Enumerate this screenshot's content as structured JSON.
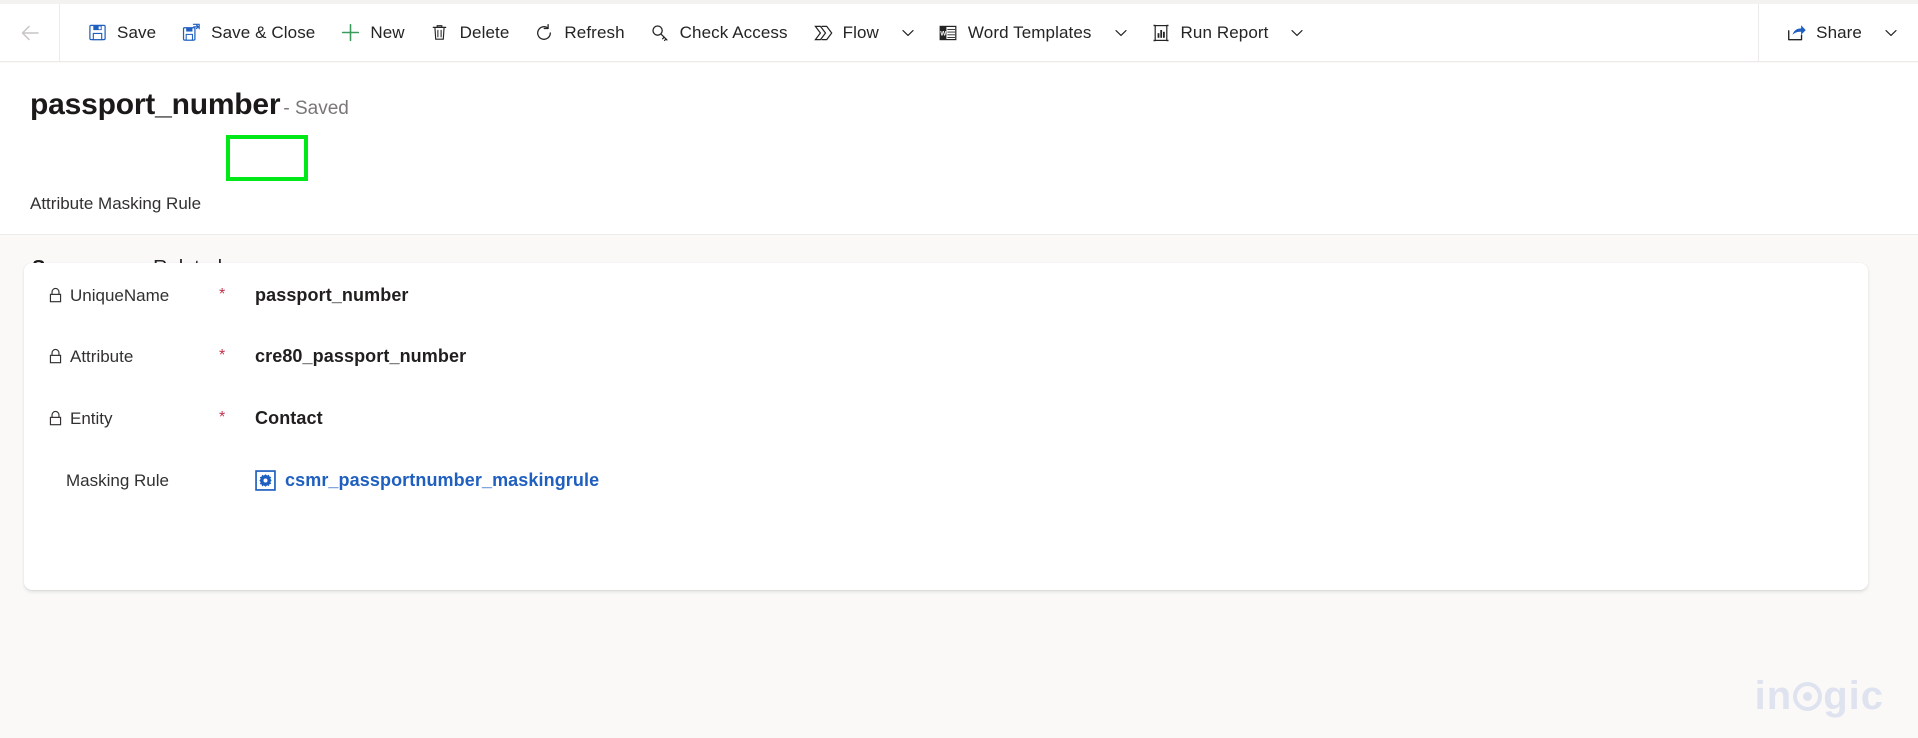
{
  "commandbar": {
    "back_icon": "back-arrow-icon",
    "items": [
      {
        "label": "Save",
        "icon": "save-icon",
        "caret": false
      },
      {
        "label": "Save & Close",
        "icon": "save-and-close-icon",
        "caret": false
      },
      {
        "label": "New",
        "icon": "plus-icon",
        "caret": false
      },
      {
        "label": "Delete",
        "icon": "trash-icon",
        "caret": false
      },
      {
        "label": "Refresh",
        "icon": "refresh-icon",
        "caret": false
      },
      {
        "label": "Check Access",
        "icon": "key-icon",
        "caret": false
      },
      {
        "label": "Flow",
        "icon": "flow-icon",
        "caret": true
      },
      {
        "label": "Word Templates",
        "icon": "word-icon",
        "caret": true
      },
      {
        "label": "Run Report",
        "icon": "report-icon",
        "caret": true
      }
    ],
    "share": {
      "label": "Share",
      "icon": "share-icon",
      "caret": true
    }
  },
  "header": {
    "title": "passport_number",
    "status": "- Saved",
    "subtitle": "Attribute Masking Rule"
  },
  "tabs": [
    {
      "label": "Summary",
      "active": true,
      "caret": false
    },
    {
      "label": "Related",
      "active": false,
      "caret": true
    }
  ],
  "form": {
    "fields": [
      {
        "label": "UniqueName",
        "locked": true,
        "required": "*",
        "value": "passport_number",
        "type": "text"
      },
      {
        "label": "Attribute",
        "locked": true,
        "required": "*",
        "value": "cre80_passport_number",
        "type": "text"
      },
      {
        "label": "Entity",
        "locked": true,
        "required": "*",
        "value": "Contact",
        "type": "text"
      },
      {
        "label": "Masking Rule",
        "locked": false,
        "required": "",
        "value": "csmr_passportnumber_maskingrule",
        "type": "lookup",
        "icon": "entity-record-icon"
      }
    ]
  },
  "annotation": {
    "highlight_color": "#00e818",
    "target": "record-status-saved"
  },
  "watermark": {
    "text_before": "in",
    "text_after": "gic",
    "color": "#dfe3ef"
  },
  "colors": {
    "accent": "#2266cc",
    "link": "#1f5fbf",
    "required": "#c4314b",
    "page_bg": "#faf9f8",
    "card_bg": "#ffffff"
  }
}
